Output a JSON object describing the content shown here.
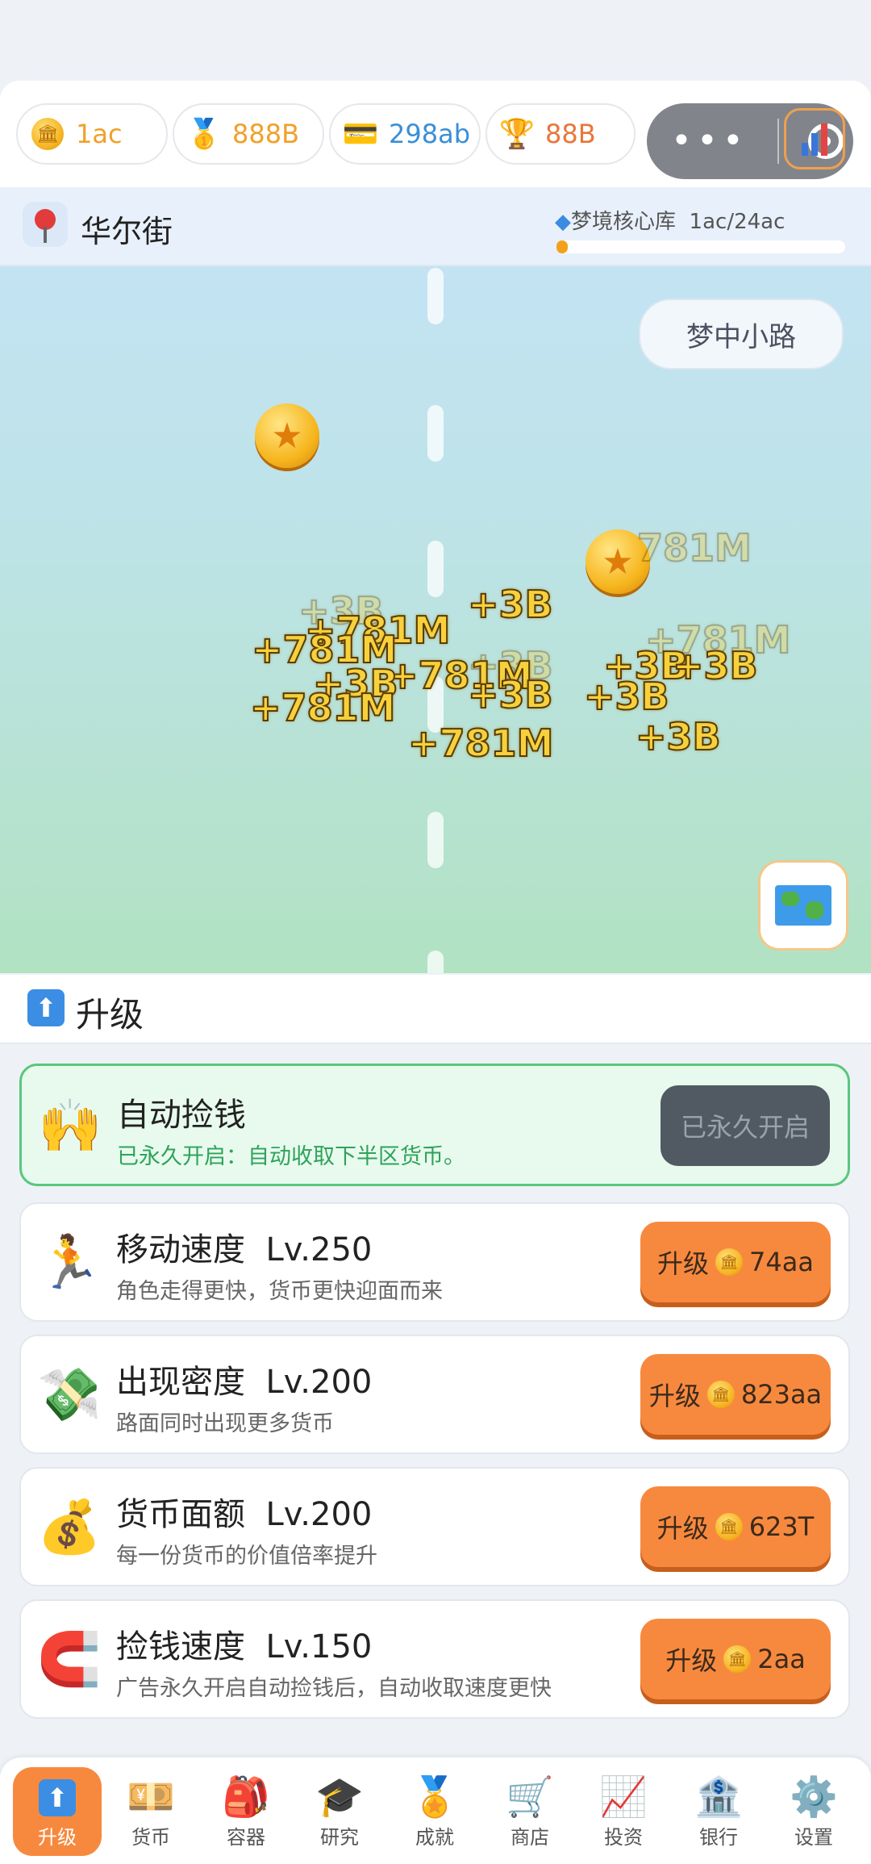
{
  "currencies": [
    {
      "icon": "bank-coin-icon",
      "value": "1ac",
      "color": "#f0a12a"
    },
    {
      "icon": "medal-icon",
      "value": "888B",
      "color": "#f0a12a"
    },
    {
      "icon": "card-icon",
      "value": "298ab",
      "color": "#3a8fd8"
    },
    {
      "icon": "trophy-icon",
      "value": "88B",
      "color": "#e8773a"
    }
  ],
  "location": {
    "name": "华尔街",
    "library_label": "梦境核心库",
    "library_value": "1ac/24ac",
    "library_progress": 0.04
  },
  "game": {
    "road_button": "梦中小路",
    "floating_texts": [
      "+3B",
      "+781M",
      "+3B",
      "+781M",
      "+781M",
      "+3B",
      "+3B",
      "+781M",
      "+3B",
      "+3B",
      "+3B",
      "+781M",
      "+781M",
      "+3B",
      "+3B",
      "781M"
    ]
  },
  "section": {
    "title": "升级"
  },
  "auto_pick": {
    "icon": "raised-hands-icon",
    "title": "自动捡钱",
    "desc": "已永久开启：自动收取下半区货币。",
    "button": "已永久开启"
  },
  "upgrades": [
    {
      "icon": "runner-icon",
      "emoji": "🏃",
      "title": "移动速度",
      "level": "Lv.250",
      "desc": "角色走得更快，货币更快迎面而来",
      "btn_label": "升级",
      "cost": "74aa"
    },
    {
      "icon": "money-wings-icon",
      "emoji": "💸",
      "title": "出现密度",
      "level": "Lv.200",
      "desc": "路面同时出现更多货币",
      "btn_label": "升级",
      "cost": "823aa"
    },
    {
      "icon": "money-bag-icon",
      "emoji": "💰",
      "title": "货币面额",
      "level": "Lv.200",
      "desc": "每一份货币的价值倍率提升",
      "btn_label": "升级",
      "cost": "623T"
    },
    {
      "icon": "magnet-icon",
      "emoji": "🧲",
      "title": "捡钱速度",
      "level": "Lv.150",
      "desc": "广告永久开启自动捡钱后，自动收取速度更快",
      "btn_label": "升级",
      "cost": "2aa"
    }
  ],
  "nav": [
    {
      "icon": "upgrade-icon",
      "label": "升级",
      "active": true
    },
    {
      "icon": "currency-icon",
      "label": "货币"
    },
    {
      "icon": "backpack-icon",
      "label": "容器"
    },
    {
      "icon": "graduation-cap-icon",
      "label": "研究"
    },
    {
      "icon": "medal-icon",
      "label": "成就"
    },
    {
      "icon": "cart-icon",
      "label": "商店"
    },
    {
      "icon": "chart-icon",
      "label": "投资"
    },
    {
      "icon": "bank-icon",
      "label": "银行"
    },
    {
      "icon": "gear-icon",
      "label": "设置"
    }
  ]
}
